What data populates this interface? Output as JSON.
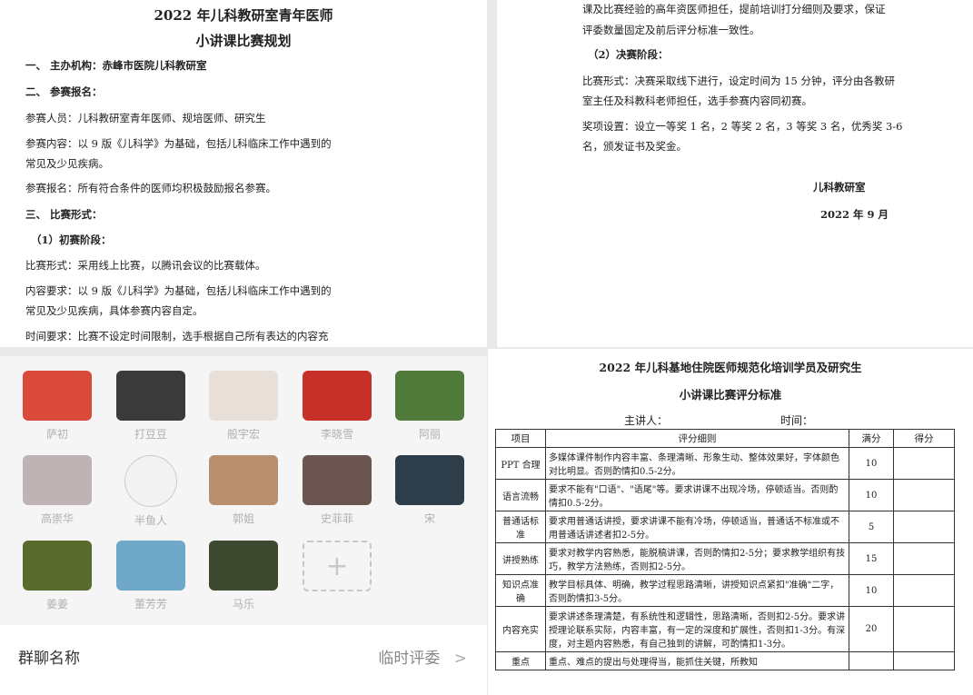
{
  "doc1": {
    "title1": "2022 年儿科教研室青年医师",
    "title2": "小讲课比赛规划",
    "lines": [
      "一、   主办机构：赤峰市医院儿科教研室",
      "二、   参赛报名：",
      "参赛人员：儿科教研室青年医师、规培医师、研究生",
      "参赛内容：以 9 版《儿科学》为基础，包括儿科临床工作中遇到的",
      "常见及少见疾病。",
      "参赛报名：所有符合条件的医师均积极鼓励报名参赛。",
      "三、   比赛形式：",
      "（1）初赛阶段：",
      "比赛形式：采用线上比赛，以腾讯会议的比赛载体。",
      "内容要求：以 9 版《儿科学》为基础，包括儿科临床工作中遇到的",
      "常见及少见疾病，具体参赛内容自定。",
      "时间要求：比赛不设定时间限制，选手根据自己所有表达的内容充"
    ]
  },
  "doc2": {
    "lines": [
      "课及比赛经验的高年资医师担任，提前培训打分细则及要求，保证",
      "评委数量固定及前后评分标准一致性。",
      "（2）决赛阶段：",
      "比赛形式：决赛采取线下进行，设定时间为 15 分钟，评分由各教研",
      "室主任及科教科老师担任，选手参赛内容同初赛。",
      "奖项设置：设立一等奖 1 名，2 等奖 2 名，3 等奖 3 名，优秀奖 3-6",
      "名，颁发证书及奖金。"
    ],
    "sign": "儿科教研室",
    "date": "2022 年 9 月"
  },
  "contacts": [
    "萨初",
    "打豆豆",
    "般宇宏",
    "李晓雪",
    "阿丽",
    "高崇华",
    "半鱼人",
    "郭姐",
    "史菲菲",
    "宋",
    "姜姜",
    "董芳芳",
    "马乐"
  ],
  "avatar_colors": [
    "#d94a3a",
    "#3a3a3a",
    "#e8dfd8",
    "#c8302a",
    "#4f7a3a",
    "#bfb3b5",
    "#f2f2f2",
    "#b89070",
    "#6b5550",
    "#2d3e4a",
    "#5a6b2e",
    "#6fa8c8",
    "#3d4a30"
  ],
  "add_label": "+",
  "group": {
    "label": "群聊名称",
    "value": "临时评委",
    "chevron": ">"
  },
  "doc3": {
    "title1": "2022 年儿科基地住院医师规范化培训学员及研究生",
    "title2": "小讲课比赛评分标准",
    "speaker": "主讲人：",
    "time": "时间：",
    "headers": [
      "项目",
      "评分细则",
      "满分",
      "得分"
    ],
    "rows": [
      {
        "item": "PPT 合理",
        "detail": "多媒体课件制作内容丰富、条理清晰、形象生动、整体效果好，字体颜色对比明显。否则酌情扣0.5-2分。",
        "score": "10"
      },
      {
        "item": "语言流畅",
        "detail": "要求不能有\"口语\"、\"语尾\"等。要求讲课不出现冷场，停顿适当。否则酌情扣0.5-2分。",
        "score": "10"
      },
      {
        "item": "普通话标准",
        "detail": "要求用普通话讲授，要求讲课不能有冷场，停顿适当，普通话不标准或不用普通话讲述者扣2-5分。",
        "score": "5"
      },
      {
        "item": "讲授熟练",
        "detail": "要求对教学内容熟悉，能脱稿讲课，否则酌情扣2-5分；要求教学组织有技巧，教学方法熟练，否则扣2-5分。",
        "score": "15"
      },
      {
        "item": "知识点准确",
        "detail": "教学目标具体、明确，教学过程思路清晰，讲授知识点紧扣\"准确\"二字，否则酌情扣3-5分。",
        "score": "10"
      },
      {
        "item": "内容充实",
        "detail": "要求讲述条理清楚，有系统性和逻辑性，思路清晰，否则扣2-5分。要求讲授理论联系实际，内容丰富，有一定的深度和扩展性，否则扣1-3分。有深度，对主题内容熟悉，有自己独到的讲解，可酌情扣1-3分。",
        "score": "20"
      },
      {
        "item": "重点",
        "detail": "重点、难点的提出与处理得当，能抓住关键，所教知",
        "score": ""
      }
    ]
  }
}
